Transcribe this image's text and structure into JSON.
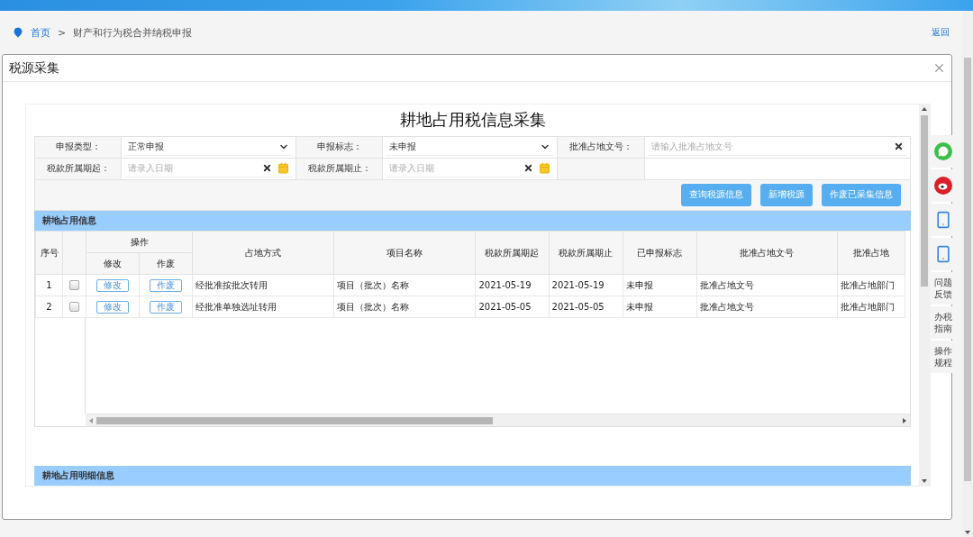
{
  "breadcrumb": {
    "items": [
      {
        "label": "首页",
        "link": true
      },
      {
        "label": "财产和行为税合并纳税申报",
        "link": false
      }
    ],
    "separator": ">",
    "back": "返回"
  },
  "dialog": {
    "title": "税源采集"
  },
  "form": {
    "title": "耕地占用税信息采集",
    "fields": [
      {
        "label": "申报类型：",
        "kind": "select",
        "value": "正常申报"
      },
      {
        "label": "申报标志：",
        "kind": "select",
        "value": "未申报"
      },
      {
        "label": "批准占地文号：",
        "kind": "text",
        "placeholder": "请输入批准占地文号"
      },
      {
        "label": "税款所属期起：",
        "kind": "date",
        "placeholder": "请录入日期"
      },
      {
        "label": "税款所属期止：",
        "kind": "date",
        "placeholder": "请录入日期"
      }
    ],
    "actions": [
      "查询税源信息",
      "新增税源",
      "作废已采集信息"
    ]
  },
  "grid": {
    "title": "耕地占用信息",
    "columns": [
      {
        "kind": "text",
        "label": "序号"
      },
      {
        "kind": "checkbox"
      },
      {
        "kind": "group",
        "label": "操作",
        "colspan": 2,
        "children": [
          {
            "label": "修改"
          },
          {
            "label": "作废"
          }
        ]
      },
      {
        "kind": "text",
        "label": "占地方式"
      },
      {
        "kind": "text",
        "label": "项目名称"
      },
      {
        "kind": "text",
        "label": "税款所属期起"
      },
      {
        "kind": "text",
        "label": "税款所属期止"
      },
      {
        "kind": "text",
        "label": "已申报标志"
      },
      {
        "kind": "text",
        "label": "批准占地文号"
      },
      {
        "kind": "text",
        "label": "批准占地"
      }
    ],
    "rows": [
      {
        "cells": [
          {
            "kind": "text",
            "text": "1"
          },
          {
            "kind": "checkbox",
            "checked": false
          },
          {
            "kind": "button",
            "text": "修改"
          },
          {
            "kind": "button",
            "text": "作废"
          },
          {
            "kind": "text",
            "text": "经批准按批次转用"
          },
          {
            "kind": "text",
            "text": "项目（批次）名称"
          },
          {
            "kind": "text",
            "text": "2021-05-19"
          },
          {
            "kind": "text",
            "text": "2021-05-19"
          },
          {
            "kind": "text",
            "text": "未申报"
          },
          {
            "kind": "text",
            "text": "批准占地文号"
          },
          {
            "kind": "text",
            "text": "批准占地部门"
          }
        ]
      },
      {
        "cells": [
          {
            "kind": "text",
            "text": "2"
          },
          {
            "kind": "checkbox",
            "checked": false
          },
          {
            "kind": "button",
            "text": "修改"
          },
          {
            "kind": "button",
            "text": "作废"
          },
          {
            "kind": "text",
            "text": "经批准单独选址转用"
          },
          {
            "kind": "text",
            "text": "项目（批次）名称"
          },
          {
            "kind": "text",
            "text": "2021-05-05"
          },
          {
            "kind": "text",
            "text": "2021-05-05"
          },
          {
            "kind": "text",
            "text": "未申报"
          },
          {
            "kind": "text",
            "text": "批准占地文号"
          },
          {
            "kind": "text",
            "text": "批准占地部门"
          }
        ]
      }
    ]
  },
  "detail": {
    "title": "耕地占用明细信息"
  },
  "side_tools": [
    {
      "kind": "chat"
    },
    {
      "kind": "weibo"
    },
    {
      "kind": "app"
    },
    {
      "kind": "app"
    },
    {
      "kind": "text",
      "label": "问题反馈"
    },
    {
      "kind": "text",
      "label": "办税指南"
    },
    {
      "kind": "text",
      "label": "操作规程"
    }
  ]
}
